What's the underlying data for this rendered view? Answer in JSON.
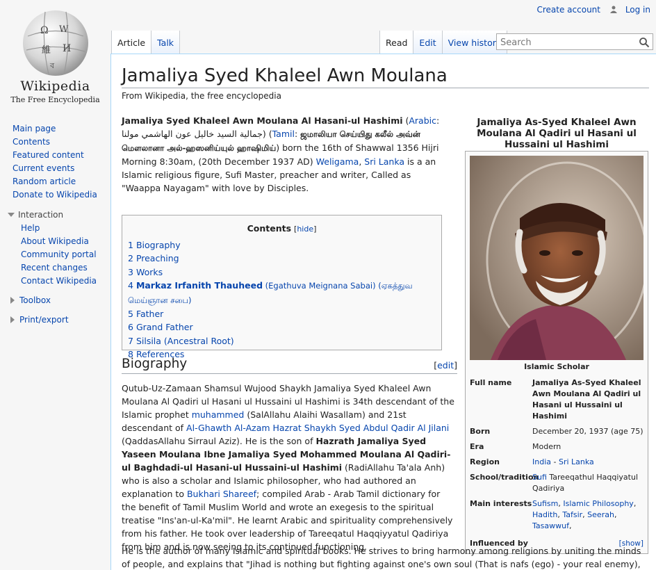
{
  "logo": {
    "wordmark": "Wikipedia",
    "tagline": "The Free Encyclopedia"
  },
  "personal": {
    "create_account": "Create account",
    "login": "Log in"
  },
  "tabs": {
    "left": [
      "Article",
      "Talk"
    ],
    "right": [
      "Read",
      "Edit",
      "View history"
    ]
  },
  "search": {
    "placeholder": "Search"
  },
  "sidebar": {
    "nav": [
      "Main page",
      "Contents",
      "Featured content",
      "Current events",
      "Random article",
      "Donate to Wikipedia"
    ],
    "interaction_label": "Interaction",
    "interaction": [
      "Help",
      "About Wikipedia",
      "Community portal",
      "Recent changes",
      "Contact Wikipedia"
    ],
    "toolbox": "Toolbox",
    "printexport": "Print/export"
  },
  "article": {
    "title": "Jamaliya Syed Khaleel Awn Moulana",
    "site_sub": "From Wikipedia, the free encyclopedia",
    "lead": {
      "name_bold": "Jamaliya Syed Khaleel Awn Moulana Al Hasani-ul Hashimi",
      "arabic_label": "Arabic",
      "arabic_text": "جمالية السيد خاليل عون الهاشمي مولنا",
      "tamil_label": "Tamil",
      "tamil_text": "ஜமாலியா செய்யிது கலீல் அவ்ன் மௌலானா அல்-ஹஸனிய்யுல் ஹாஷிமிய்",
      "born_text_1": " born the 16th of Shawwal 1356 Hijri Morning 8:30am, (20th December 1937 AD) ",
      "weligama": "Weligama",
      "srilanka": "Sri Lanka",
      "rest": " is a an Islamic religious figure, Sufi Master, preacher and writer, Called as \"Waappa Nayagam\" with love by Disciples."
    },
    "toc": {
      "title": "Contents",
      "hide": "hide",
      "items": [
        {
          "num": "1",
          "text": "Biography"
        },
        {
          "num": "2",
          "text": "Preaching"
        },
        {
          "num": "3",
          "text": "Works"
        },
        {
          "num": "4",
          "bold": "Markaz Irfanith Thauheed",
          "text": " (Egathuva Meignana Sabai) (ஏகத்துவ மெய்ஞான சபை)"
        },
        {
          "num": "5",
          "text": "Father"
        },
        {
          "num": "6",
          "text": "Grand Father"
        },
        {
          "num": "7",
          "text": "Silsila (Ancestral Root)"
        },
        {
          "num": "8",
          "text": "References"
        }
      ]
    },
    "biography": {
      "heading": "Biography",
      "edit": "edit",
      "p1_a": "Qutub-Uz-Zamaan Shamsul Wujood Shaykh Jamaliya Syed Khaleel Awn Moulana Al Qadiri ul Hasani ul Hussaini ul Hashimi is 34th descendant of the Islamic prophet ",
      "p1_muhammed": "muhammed",
      "p1_b": " (SalAllahu Alaihi Wasallam) and 21st descendant of ",
      "p1_ghawth": "Al-Ghawth Al-Azam Hazrat Shaykh Syed Abdul Qadir Al Jilani",
      "p1_c": " (QaddasAllahu Sirraul Aziz). He is the son of ",
      "p1_father": "Hazrath Jamaliya Syed Yaseen Moulana Ibne Jamaliya Syed Mohammed Moulana Al Qadiri-ul Baghdadi-ul Hasani-ul Hussaini-ul Hashimi",
      "p1_d": " (RadiAllahu Ta'ala Anh) who is also a scholar and Islamic philosopher, who had authored an explanation to ",
      "p1_bukhari": "Bukhari Shareef",
      "p1_e": "; compiled Arab - Arab Tamil dictionary for the benefit of Tamil Muslim World and wrote an exegesis to the spiritual treatise \"Ins'an-ul-Ka'mil\". He learnt Arabic and spirituality comprehensively from his father. He took over leadership of Tareeqatul Haqqiyyatul Qadiriya from him and is now seeing to its continued functioning.",
      "p2": "He is the author of many Islamic and spiritual books. He strives to bring harmony among religions by uniting the minds of people, and explains that \"Jihad is nothing but fighting against one's own soul (That is nafs (ego) - your real enemy), which is called Jihad-"
    }
  },
  "infobox": {
    "caption": "Jamaliya As-Syed Khaleel Awn Moulana Al Qadiri ul Hasani ul Hussaini ul Hashimi",
    "image_caption": "Islamic Scholar",
    "full_name_label": "Full name",
    "full_name": "Jamaliya As-Syed Khaleel Awn Moulana Al Qadiri ul Hasani ul Hussaini ul Hashimi",
    "born_label": "Born",
    "born": "December 20, 1937 (age 75)",
    "era_label": "Era",
    "era": "Modern",
    "region_label": "Region",
    "region_india": "India",
    "region_sep": " - ",
    "region_srilanka": "Sri Lanka",
    "school_label": "School/tradition",
    "school_sufi": "Sufi",
    "school_rest": " Tareeqathul Haqqiyatul Qadiriya",
    "interests_label": "Main interests",
    "interests": [
      "Sufism",
      "Islamic Philosophy",
      "Hadith",
      "Tafsir",
      "Seerah",
      "Tasawwuf"
    ],
    "influenced_label": "Influenced by",
    "show": "[show]"
  },
  "colors": {
    "link": "#0645ad",
    "border": "#a7d7f9"
  }
}
